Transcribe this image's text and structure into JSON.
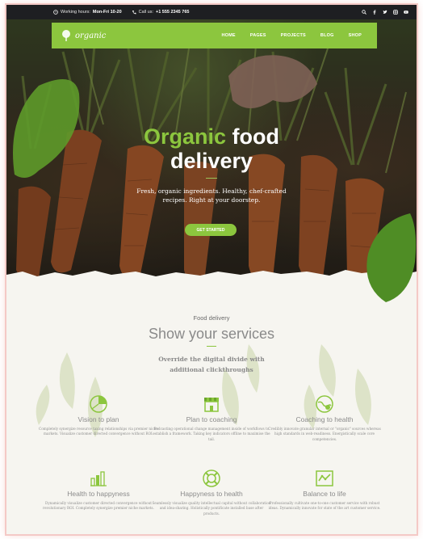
{
  "topbar": {
    "hours_label": "Working hours:",
    "hours_value": "Mon-Fri 10-20",
    "call_label": "Call us:",
    "call_value": "+1 555 2345 765"
  },
  "nav": {
    "logo": "organic",
    "menu": [
      "HOME",
      "PAGES",
      "PROJECTS",
      "BLOG",
      "SHOP"
    ]
  },
  "hero": {
    "title_green": "Organic",
    "title_white": "food",
    "title_line2": "delivery",
    "subtitle": "Fresh, organic ingredients. Healthy, chef-crafted recipes. Right at your doorstep.",
    "cta": "GET STARTED"
  },
  "services": {
    "eyebrow": "Food delivery",
    "title": "Show your services",
    "description": "Override the digital divide with additional clickthroughs",
    "cards": [
      {
        "icon": "pie-chart-icon",
        "title": "Vision to plan",
        "text": "Completely synergize resource taxing relationships via premier niche markets. Visualize customer directed convergence without ROI."
      },
      {
        "icon": "shop-icon",
        "title": "Plan to coaching",
        "text": "Podcasting operational change management inside of workflows to establish a framework. Taking key indicators offline to maximise the tail."
      },
      {
        "icon": "globe-icon",
        "title": "Coaching to health",
        "text": "Credibly innovate granular internal or \"organic\" sources whereas high standards in web-readiness. Energistically scale core competencies."
      },
      {
        "icon": "bar-chart-icon",
        "title": "Health to happyness",
        "text": "Dynamically visualize customer directed convergence without revolutionary ROI. Completely synergize premier niche markets."
      },
      {
        "icon": "lifebuoy-icon",
        "title": "Happyness to health",
        "text": "Seamlessly visualize quality intellectual capital without collaboration and idea-sharing. Holistically pontificate installed base after products."
      },
      {
        "icon": "line-graph-icon",
        "title": "Balance to life",
        "text": "Professionally cultivate one-to-one customer service with robust ideas. Dynamically innovate for state of the art customer service."
      }
    ]
  },
  "colors": {
    "accent": "#8cc63e",
    "topbar": "#1e1f22",
    "background": "#f6f5f0"
  }
}
